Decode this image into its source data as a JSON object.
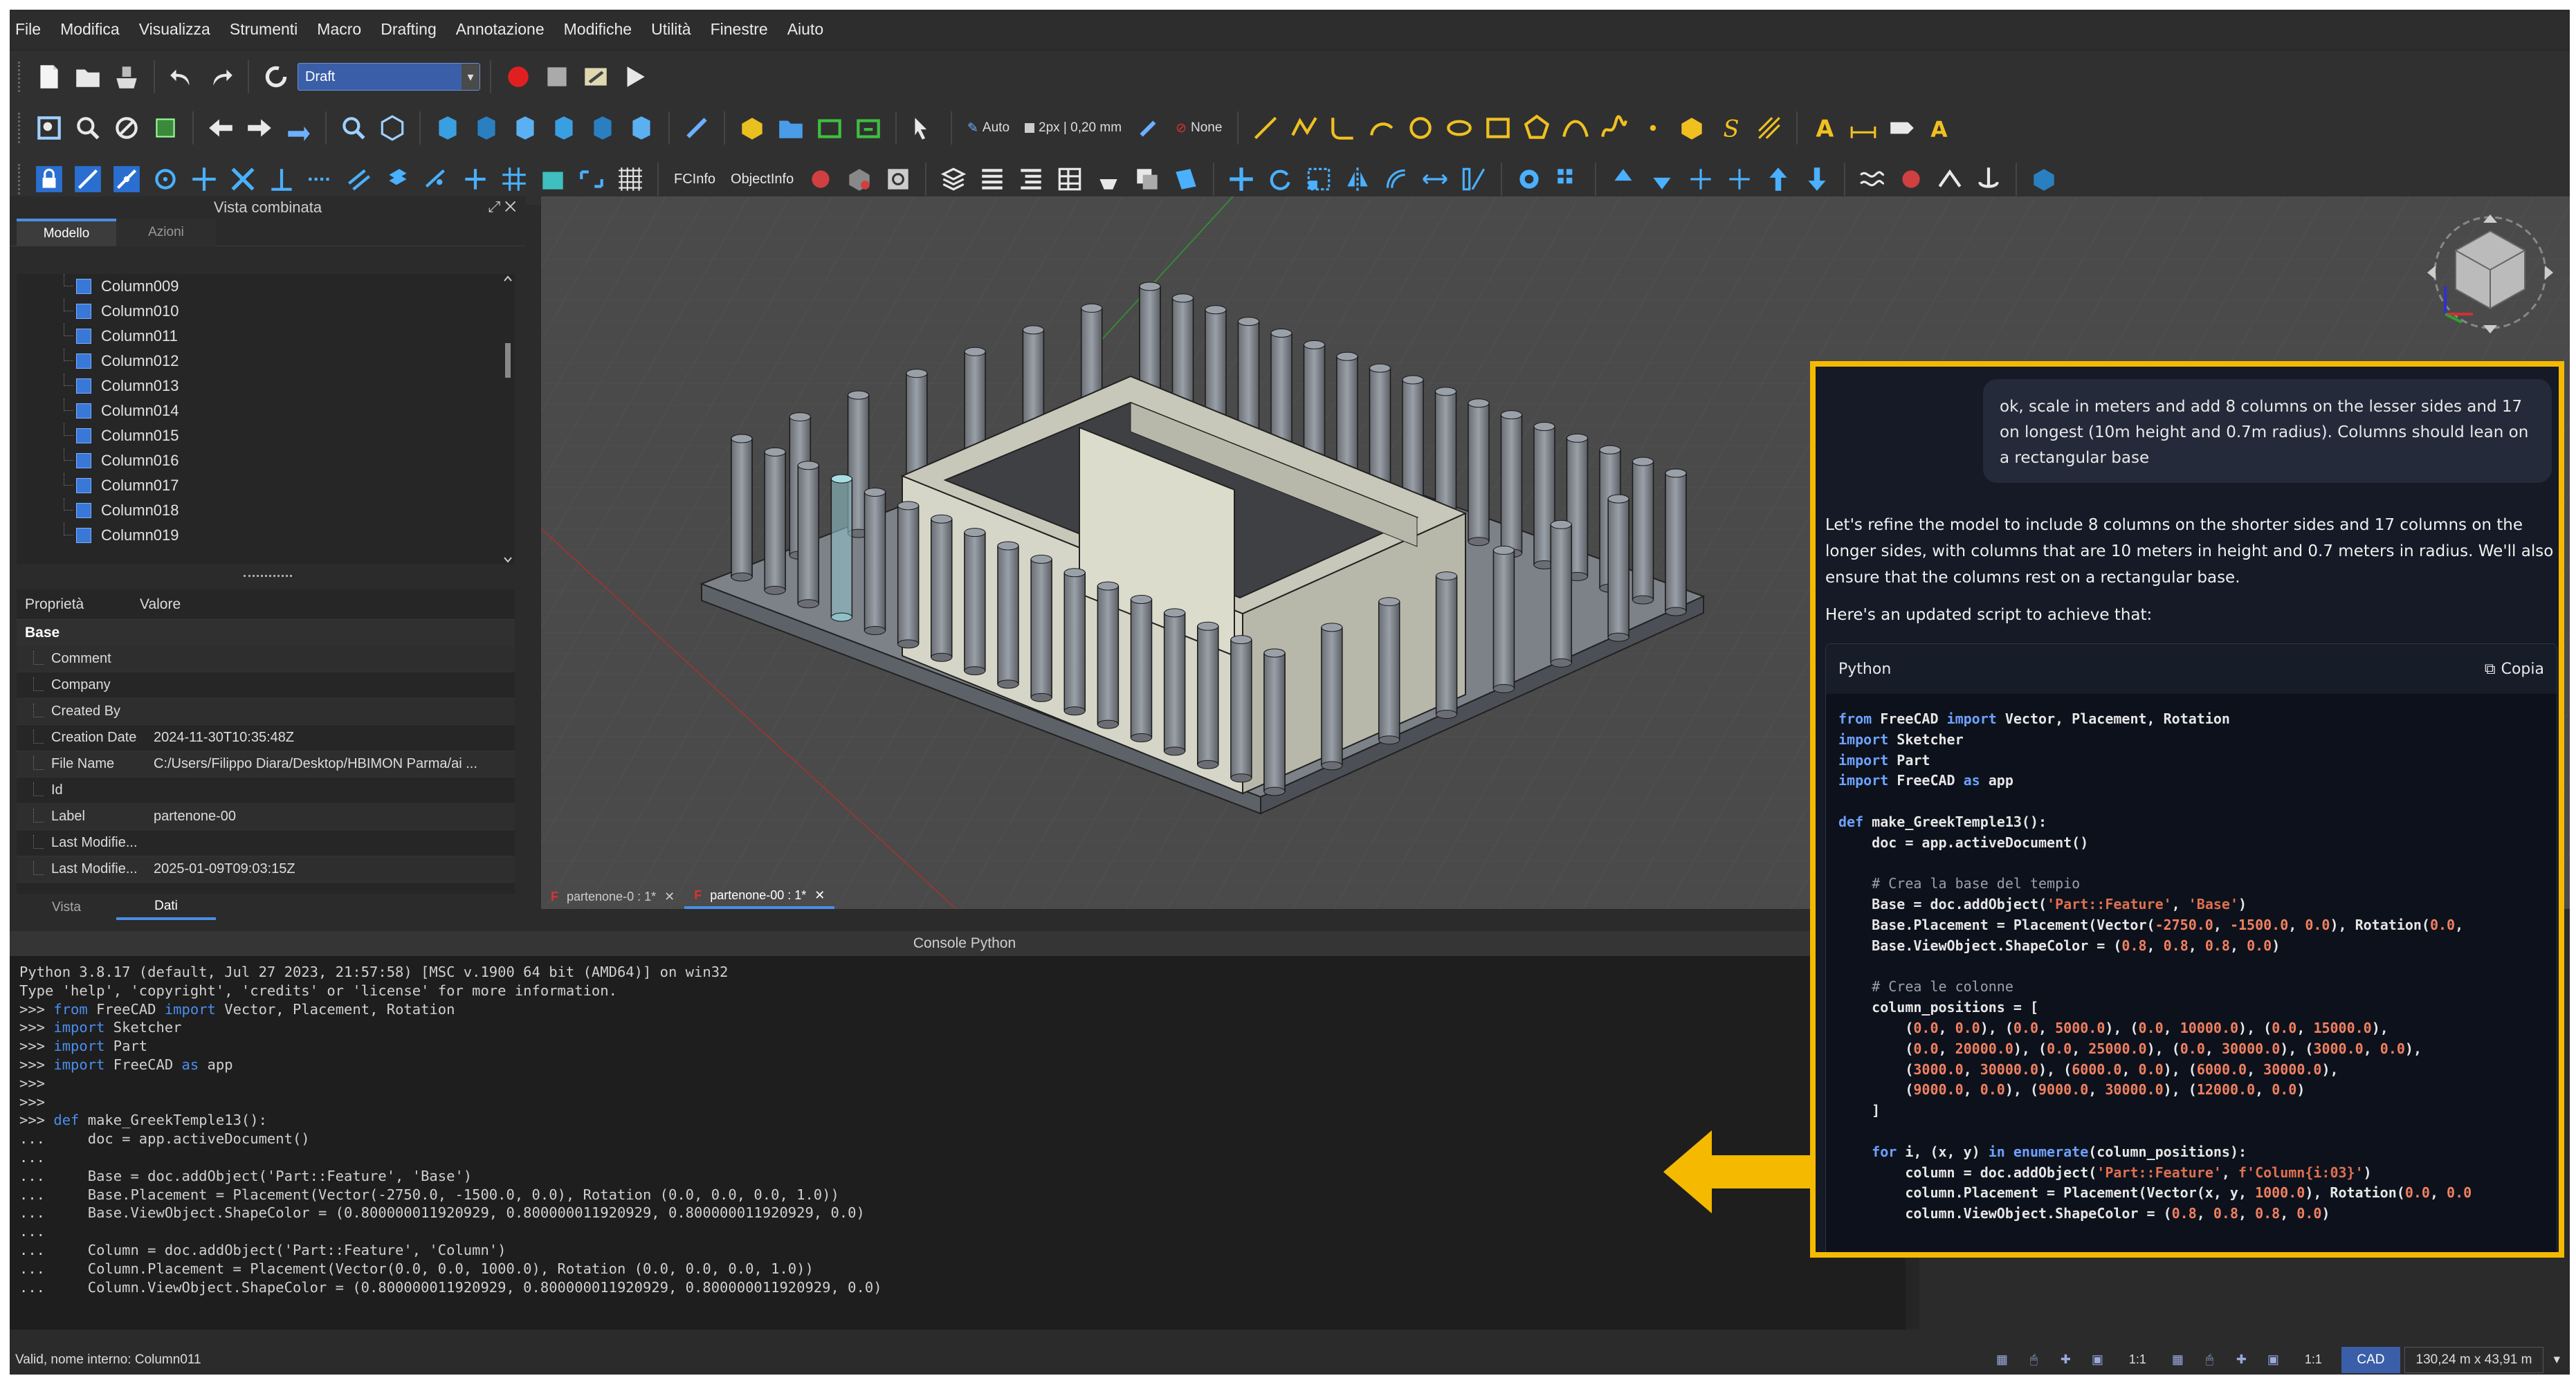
{
  "menu": [
    "File",
    "Modifica",
    "Visualizza",
    "Strumenti",
    "Macro",
    "Drafting",
    "Annotazione",
    "Modifiche",
    "Utilità",
    "Finestre",
    "Aiuto"
  ],
  "workbench": "Draft",
  "toolbar": {
    "snap_auto": "Auto",
    "line_width": "2px | 0,20 mm",
    "color_none": "None",
    "fcinfo": "FCInfo",
    "objectinfo": "ObjectInfo"
  },
  "combo": {
    "title": "Vista combinata",
    "tab_model": "Modello",
    "tab_actions": "Azioni"
  },
  "tree": [
    "Column009",
    "Column010",
    "Column011",
    "Column012",
    "Column013",
    "Column014",
    "Column015",
    "Column016",
    "Column017",
    "Column018",
    "Column019"
  ],
  "props": {
    "col_prop": "Proprietà",
    "col_val": "Valore",
    "group": "Base",
    "rows": [
      {
        "k": "Comment",
        "v": ""
      },
      {
        "k": "Company",
        "v": ""
      },
      {
        "k": "Created By",
        "v": ""
      },
      {
        "k": "Creation Date",
        "v": "2024-11-30T10:35:48Z"
      },
      {
        "k": "File Name",
        "v": "C:/Users/Filippo Diara/Desktop/HBIMON Parma/ai ..."
      },
      {
        "k": "Id",
        "v": ""
      },
      {
        "k": "Label",
        "v": "partenone-00"
      },
      {
        "k": "Last Modifie...",
        "v": ""
      },
      {
        "k": "Last Modifie...",
        "v": "2025-01-09T09:03:15Z"
      }
    ]
  },
  "bottom_tabs": {
    "view": "Vista",
    "data": "Dati"
  },
  "doc_tabs": [
    {
      "label": "partenone-0 : 1*"
    },
    {
      "label": "partenone-00 : 1*"
    }
  ],
  "console": {
    "title": "Console Python",
    "lines": [
      "Python 3.8.17 (default, Jul 27 2023, 21:57:58) [MSC v.1900 64 bit (AMD64)] on win32",
      "Type 'help', 'copyright', 'credits' or 'license' for more information.",
      ">>> from FreeCAD import Vector, Placement, Rotation",
      ">>> import Sketcher",
      ">>> import Part",
      ">>> import FreeCAD as app",
      ">>> ",
      ">>> ",
      ">>> def make_GreekTemple13():",
      "...     doc = app.activeDocument()",
      "... ",
      "...     Base = doc.addObject('Part::Feature', 'Base')",
      "...     Base.Placement = Placement(Vector(-2750.0, -1500.0, 0.0), Rotation (0.0, 0.0, 0.0, 1.0))",
      "...     Base.ViewObject.ShapeColor = (0.800000011920929, 0.800000011920929, 0.800000011920929, 0.0)",
      "... ",
      "...     Column = doc.addObject('Part::Feature', 'Column')",
      "...     Column.Placement = Placement(Vector(0.0, 0.0, 1000.0), Rotation (0.0, 0.0, 0.0, 1.0))",
      "...     Column.ViewObject.ShapeColor = (0.800000011920929, 0.800000011920929, 0.800000011920929, 0.0)"
    ]
  },
  "status": {
    "message": "Valid, nome interno: Column011",
    "ratio1": "1:1",
    "ratio2": "1:1",
    "cad": "CAD",
    "dims": "130,24 m x 43,91 m"
  },
  "chat": {
    "user": "ok, scale in meters and add 8 columns on the lesser sides and 17 on longest (10m height and 0.7m radius). Columns should lean on a rectangular base",
    "reply1": "Let's refine the model to include 8 columns on the shorter sides and 17 columns on the longer sides, with columns that are 10 meters in height and 0.7 meters in radius. We'll also ensure that the columns rest on a rectangular base.",
    "reply2": "Here's an updated script to achieve that:",
    "code_lang": "Python",
    "copy": "Copia"
  },
  "colors": {
    "accent": "#4a8ee5",
    "highlight": "#f5b900",
    "workbench": "#3a5fa8"
  }
}
